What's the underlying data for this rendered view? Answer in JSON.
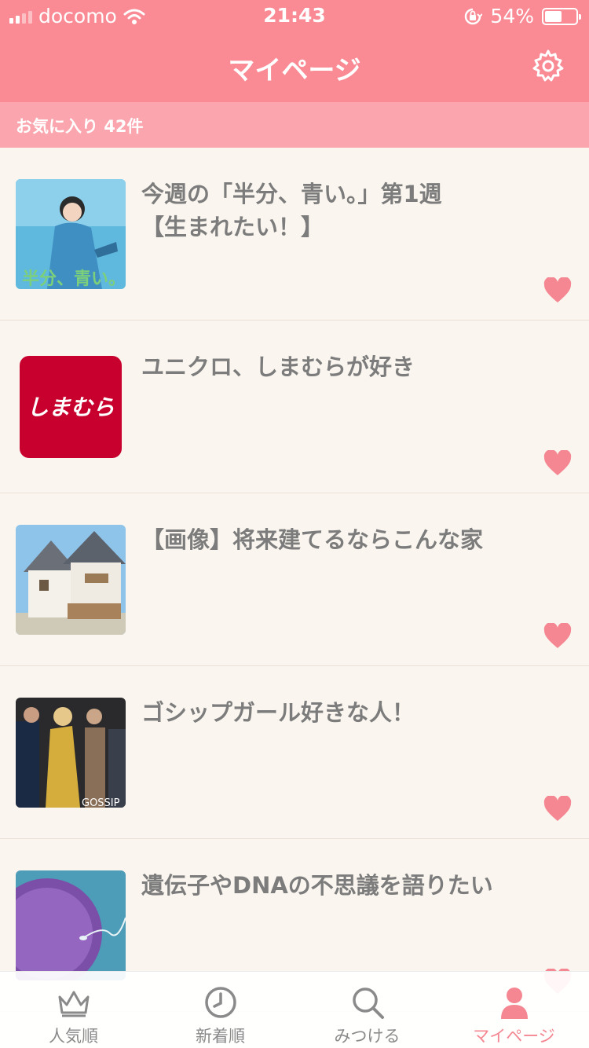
{
  "status": {
    "carrier": "docomo",
    "time": "21:43",
    "battery": "54%",
    "battery_level": 0.54
  },
  "header": {
    "title": "マイページ"
  },
  "favorites": {
    "label": "お気に入り 42件"
  },
  "items": [
    {
      "title": "今週の「半分、青い。」第1週\n【生まれたい！】",
      "thumb_text": "半分、青い。"
    },
    {
      "title": "ユニクロ、しまむらが好き",
      "thumb_text": "しまむら"
    },
    {
      "title": "【画像】将来建てるならこんな家"
    },
    {
      "title": "ゴシップガール好きな人！",
      "thumb_text": "GOSSIP"
    },
    {
      "title": "遺伝子やDNAの不思議を語りたい"
    }
  ],
  "tabs": [
    {
      "label": "人気順",
      "icon": "crown-icon"
    },
    {
      "label": "新着順",
      "icon": "clock-icon"
    },
    {
      "label": "みつける",
      "icon": "search-icon"
    },
    {
      "label": "マイページ",
      "icon": "person-icon",
      "active": true
    }
  ],
  "colors": {
    "accent": "#fa8a94",
    "heart": "#f58792",
    "background": "#faf6ef"
  }
}
